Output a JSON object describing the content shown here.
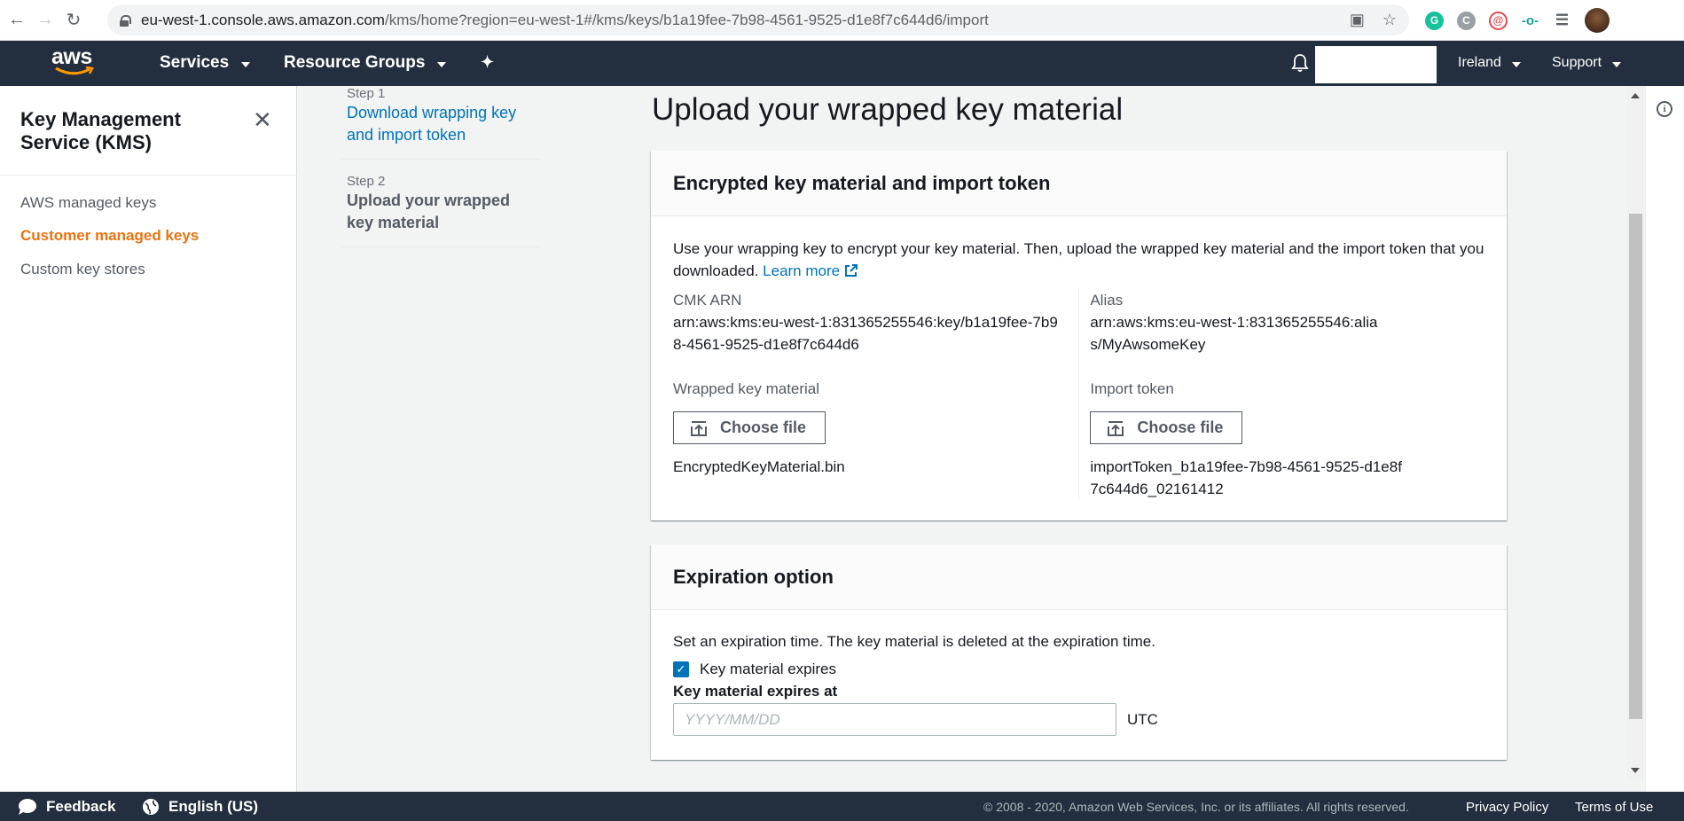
{
  "browser": {
    "url_host": "eu-west-1.console.aws.amazon.com",
    "url_path": "/kms/home?region=eu-west-1#/kms/keys/b1a19fee-7b98-4561-9525-d1e8f7c644d6/import"
  },
  "top_nav": {
    "logo": "aws",
    "services": "Services",
    "resource_groups": "Resource Groups",
    "region": "Ireland",
    "support": "Support"
  },
  "sidebar": {
    "title": "Key Management Service (KMS)",
    "items": [
      {
        "label": "AWS managed keys",
        "active": false
      },
      {
        "label": "Customer managed keys",
        "active": true
      },
      {
        "label": "Custom key stores",
        "active": false
      }
    ]
  },
  "steps": [
    {
      "number": "Step 1",
      "label": "Download wrapping key and import token",
      "current": false
    },
    {
      "number": "Step 2",
      "label": "Upload your wrapped key material",
      "current": true
    }
  ],
  "page_title": "Upload your wrapped key material",
  "encrypted_panel": {
    "title": "Encrypted key material and import token",
    "description": "Use your wrapping key to encrypt your key material. Then, upload the wrapped key material and the import token that you downloaded.",
    "learn_more": "Learn more",
    "cmk_arn_label": "CMK ARN",
    "cmk_arn_value": "arn:aws:kms:eu-west-1:831365255546:key/b1a19fee-7b98-4561-9525-d1e8f7c644d6",
    "alias_label": "Alias",
    "alias_value": "arn:aws:kms:eu-west-1:831365255546:alias/MyAwsomeKey",
    "wrapped_label": "Wrapped key material",
    "wrapped_button": "Choose file",
    "wrapped_file": "EncryptedKeyMaterial.bin",
    "token_label": "Import token",
    "token_button": "Choose file",
    "token_file": "importToken_b1a19fee-7b98-4561-9525-d1e8f7c644d6_02161412"
  },
  "expiration_panel": {
    "title": "Expiration option",
    "description": "Set an expiration time. The key material is deleted at the expiration time.",
    "checkbox_label": "Key material expires",
    "checkbox_checked": true,
    "expires_at_label": "Key material expires at",
    "date_placeholder": "YYYY/MM/DD",
    "timezone": "UTC"
  },
  "footer": {
    "feedback": "Feedback",
    "language": "English (US)",
    "copyright": "© 2008 - 2020, Amazon Web Services, Inc. or its affiliates. All rights reserved.",
    "privacy": "Privacy Policy",
    "terms": "Terms of Use"
  },
  "colors": {
    "nav_bg": "#232f3e",
    "accent_orange": "#ec7211",
    "link_blue": "#0073bb"
  }
}
